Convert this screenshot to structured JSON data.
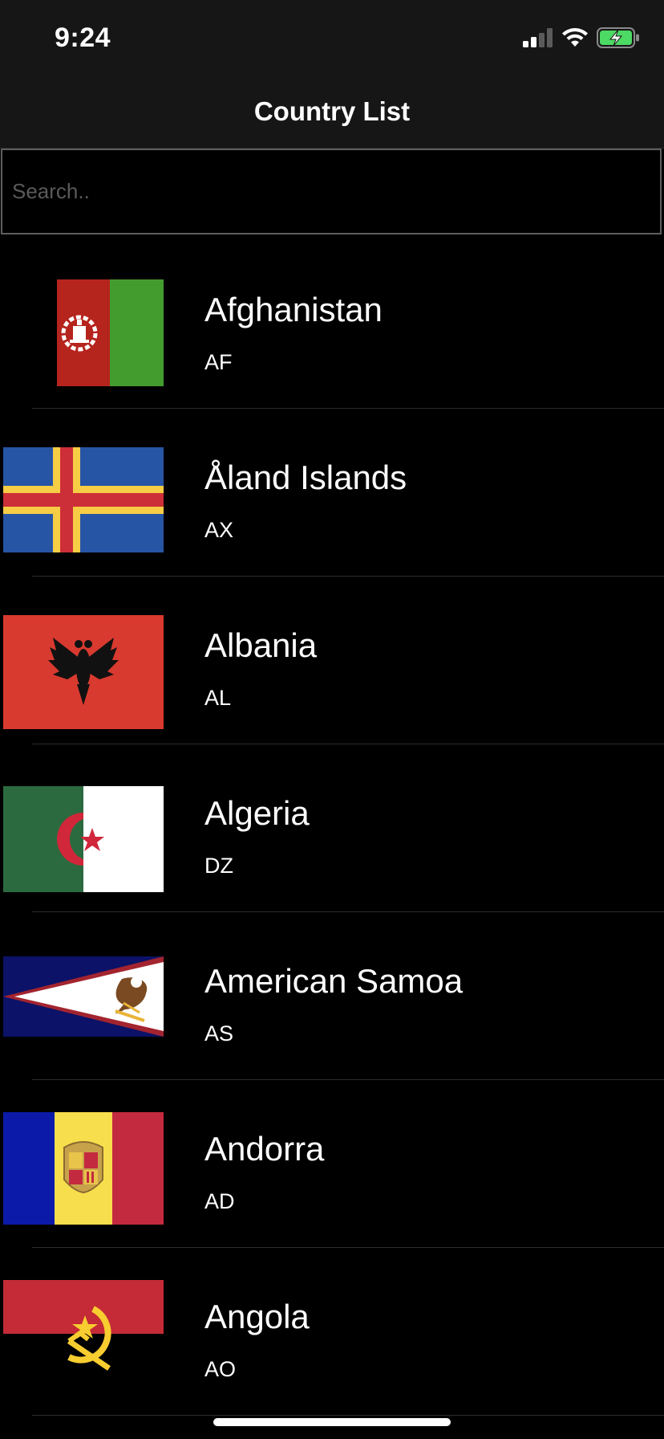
{
  "status_bar": {
    "time": "9:24",
    "icons": [
      "cellular-signal-icon",
      "wifi-icon",
      "battery-charging-icon"
    ]
  },
  "nav": {
    "title": "Country List"
  },
  "search": {
    "placeholder": "Search..",
    "value": ""
  },
  "countries": [
    {
      "name": "Afghanistan",
      "code": "AF",
      "flag": "afghanistan-flag-icon"
    },
    {
      "name": "Åland Islands",
      "code": "AX",
      "flag": "aland-islands-flag-icon"
    },
    {
      "name": "Albania",
      "code": "AL",
      "flag": "albania-flag-icon"
    },
    {
      "name": "Algeria",
      "code": "DZ",
      "flag": "algeria-flag-icon"
    },
    {
      "name": "American Samoa",
      "code": "AS",
      "flag": "american-samoa-flag-icon"
    },
    {
      "name": "Andorra",
      "code": "AD",
      "flag": "andorra-flag-icon"
    },
    {
      "name": "Angola",
      "code": "AO",
      "flag": "angola-flag-icon"
    }
  ],
  "colors": {
    "background": "#000000",
    "bar_background": "#161616",
    "text": "#ffffff",
    "battery_green": "#4cd964"
  }
}
